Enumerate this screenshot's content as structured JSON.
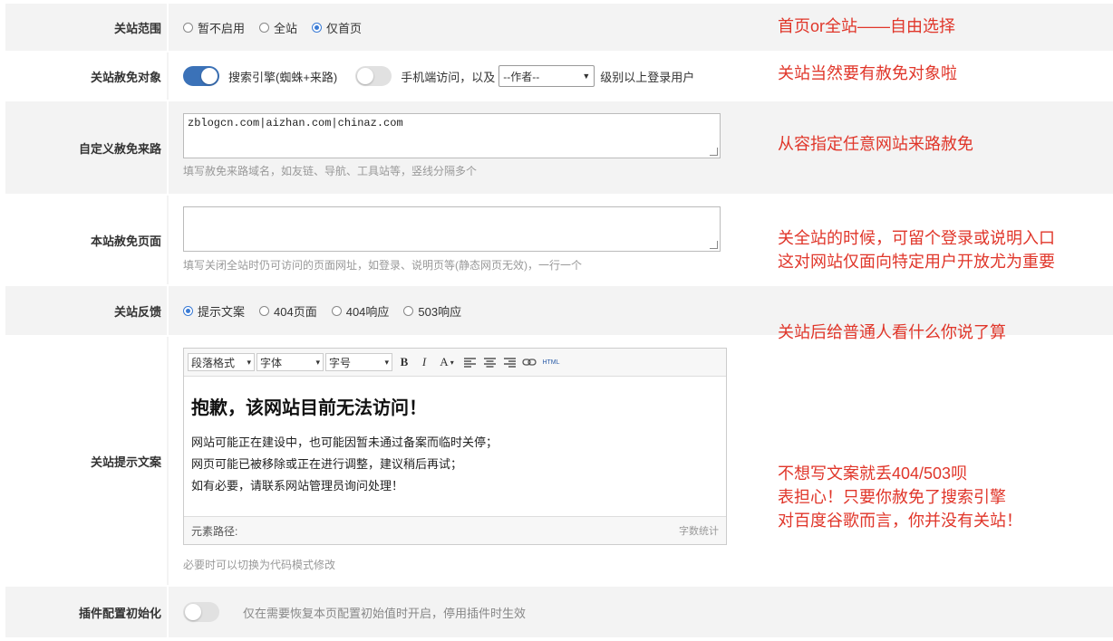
{
  "rows": {
    "scope": {
      "label": "关站范围",
      "options": [
        "暂不启用",
        "全站",
        "仅首页"
      ],
      "selected": "仅首页"
    },
    "exempt": {
      "label": "关站赦免对象",
      "toggle1_label": "搜索引擎(蜘蛛+来路)",
      "toggle1_on": true,
      "toggle2_label": "手机端访问",
      "toggle2_on": false,
      "connector": "，以及",
      "role_select": "--作者--",
      "suffix": "级别以上登录用户"
    },
    "referrer": {
      "label": "自定义赦免来路",
      "value": "zblogcn.com|aizhan.com|chinaz.com",
      "hint": "填写赦免来路域名，如友链、导航、工具站等，竖线分隔多个"
    },
    "pages": {
      "label": "本站赦免页面",
      "value": "",
      "hint": "填写关闭全站时仍可访问的页面网址，如登录、说明页等(静态网页无效)，一行一个"
    },
    "feedback": {
      "label": "关站反馈",
      "options": [
        "提示文案",
        "404页面",
        "404响应",
        "503响应"
      ],
      "selected": "提示文案"
    },
    "message": {
      "label": "关站提示文案",
      "toolbar": {
        "paragraph": "段落格式",
        "font": "字体",
        "size": "字号",
        "bold": "B",
        "italic": "I",
        "color": "A",
        "html": "HTML"
      },
      "heading": "抱歉，该网站目前无法访问！",
      "lines": [
        "网站可能正在建设中，也可能因暂未通过备案而临时关停；",
        "网页可能已被移除或正在进行调整，建议稍后再试；",
        "如有必要，请联系网站管理员询问处理！"
      ],
      "status_path": "元素路径:",
      "status_count": "字数统计",
      "hint": "必要时可以切换为代码模式修改"
    },
    "reset": {
      "label": "插件配置初始化",
      "toggle_on": false,
      "hint": "仅在需要恢复本页配置初始值时开启，停用插件时生效"
    }
  },
  "notes": {
    "n1": "首页or全站——自由选择",
    "n2": "关站当然要有赦免对象啦",
    "n3": "从容指定任意网站来路赦免",
    "n4a": "关全站的时候，可留个登录或说明入口",
    "n4b": "这对网站仅面向特定用户开放尤为重要",
    "n5": "关站后给普通人看什么你说了算",
    "n6a": "不想写文案就丢404/503呗",
    "n6b": "表担心！只要你赦免了搜索引擎",
    "n6c": "对百度谷歌而言，你并没有关站！"
  },
  "colors": {
    "note_red": "#e0362a",
    "toggle_on": "#3b72b8",
    "radio_on": "#3a7bd5"
  }
}
